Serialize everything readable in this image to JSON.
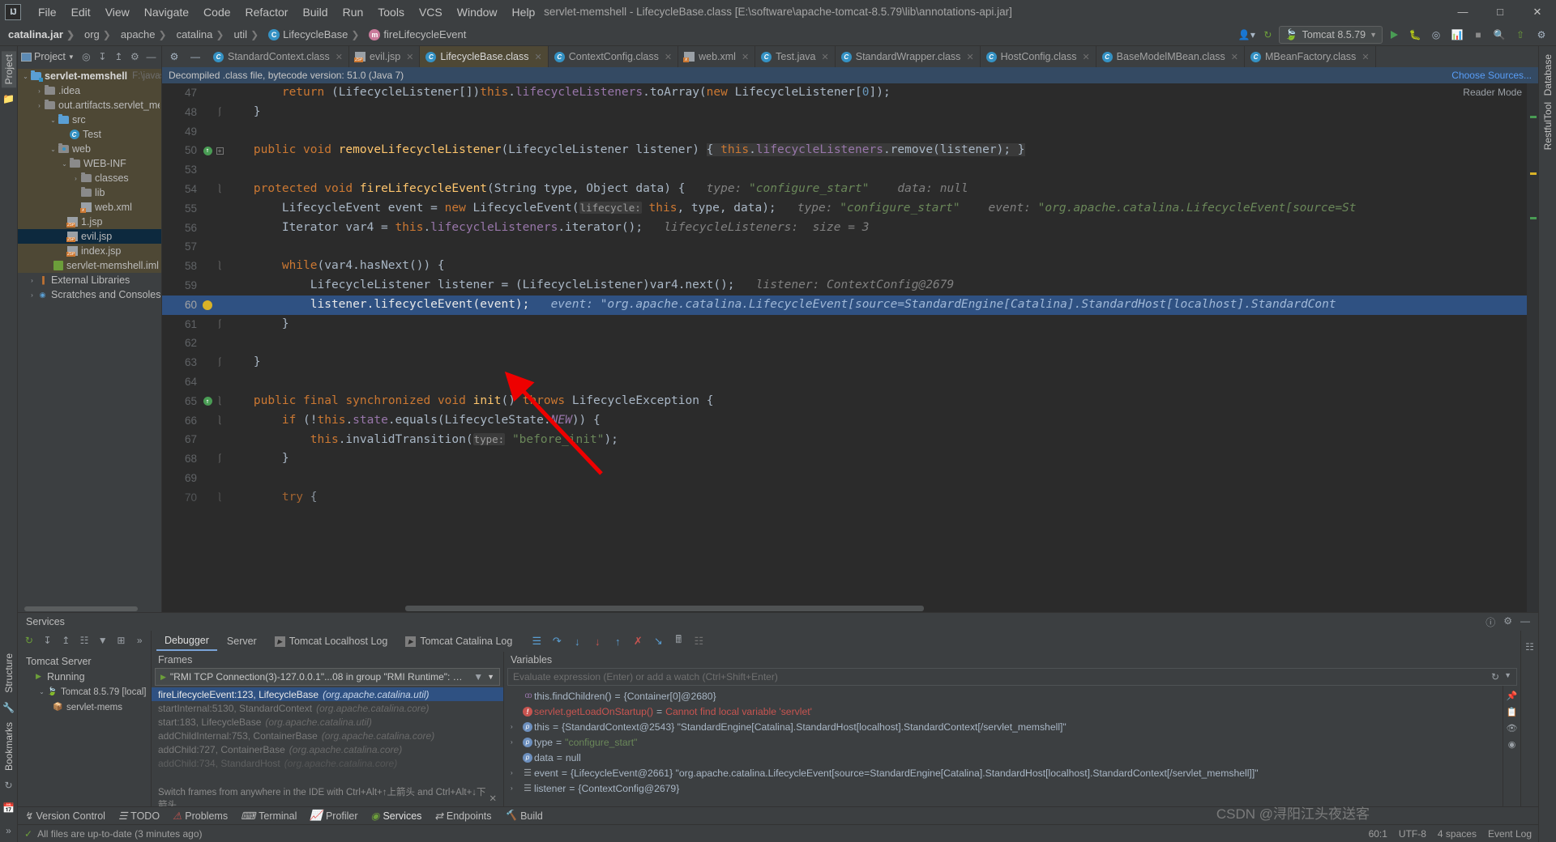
{
  "menu": {
    "logo": "IJ",
    "items": [
      "File",
      "Edit",
      "View",
      "Navigate",
      "Code",
      "Refactor",
      "Build",
      "Run",
      "Tools",
      "VCS",
      "Window",
      "Help"
    ],
    "window_title": "servlet-memshell - LifecycleBase.class [E:\\software\\apache-tomcat-8.5.79\\lib\\annotations-api.jar]",
    "controls": {
      "minimize": "—",
      "maximize": "□",
      "close": "✕"
    }
  },
  "navbar": {
    "breadcrumbs": [
      {
        "label": "catalina.jar",
        "icon": "",
        "bold": true
      },
      {
        "label": "org",
        "icon": ""
      },
      {
        "label": "apache",
        "icon": ""
      },
      {
        "label": "catalina",
        "icon": ""
      },
      {
        "label": "util",
        "icon": ""
      },
      {
        "label": "LifecycleBase",
        "icon": "class-icon"
      },
      {
        "label": "fireLifecycleEvent",
        "icon": "method-icon"
      }
    ],
    "run_config": "Tomcat 8.5.79",
    "buttons": [
      "run-button",
      "debug-button",
      "stop-button",
      "coverage-button",
      "profiler-button",
      "search-button",
      "update-button",
      "settings-button"
    ]
  },
  "sidebar_left": {
    "project_label": "Project",
    "structure_label": "Structure",
    "bookmarks_label": "Bookmarks"
  },
  "sidebar_right": {
    "database_label": "Database",
    "restful_label": "RestfulTool"
  },
  "project": {
    "header": "Project",
    "toolbar_icons": [
      "locate-icon",
      "expand-all-icon",
      "collapse-all-icon",
      "settings-icon",
      "hide-icon"
    ],
    "tree": [
      {
        "depth": 0,
        "arrow": "⌄",
        "icon": "module-folder",
        "label": "servlet-memshell",
        "bold": true,
        "path": "F:\\javasec-e",
        "state": "hi"
      },
      {
        "depth": 1,
        "arrow": "›",
        "icon": "folder",
        "label": ".idea",
        "state": "hi"
      },
      {
        "depth": 1,
        "arrow": "›",
        "icon": "folder",
        "label": "out.artifacts.servlet_memshell",
        "state": "hi"
      },
      {
        "depth": 1,
        "arrow": "⌄",
        "icon": "folder-blue",
        "label": "src",
        "state": "hi"
      },
      {
        "depth": 2,
        "arrow": "",
        "icon": "class-icon",
        "label": "Test",
        "state": "hi"
      },
      {
        "depth": 1,
        "arrow": "⌄",
        "icon": "web-folder",
        "label": "web",
        "state": "hi"
      },
      {
        "depth": 2,
        "arrow": "⌄",
        "icon": "folder",
        "label": "WEB-INF",
        "state": "hi"
      },
      {
        "depth": 3,
        "arrow": "›",
        "icon": "folder",
        "label": "classes",
        "state": "hi"
      },
      {
        "depth": 3,
        "arrow": "",
        "icon": "folder",
        "label": "lib",
        "state": "hi"
      },
      {
        "depth": 3,
        "arrow": "",
        "icon": "xml-icon",
        "label": "web.xml",
        "state": "hi"
      },
      {
        "depth": 2,
        "arrow": "",
        "icon": "jsp-icon",
        "label": "1.jsp",
        "state": "hi"
      },
      {
        "depth": 2,
        "arrow": "",
        "icon": "jsp-icon",
        "label": "evil.jsp",
        "state": "sel"
      },
      {
        "depth": 2,
        "arrow": "",
        "icon": "jsp-icon",
        "label": "index.jsp",
        "state": "hi"
      },
      {
        "depth": 1,
        "arrow": "",
        "icon": "iml-icon",
        "label": "servlet-memshell.iml",
        "state": "hi"
      },
      {
        "depth": 0,
        "arrow": "›",
        "icon": "lib-icon",
        "label": "External Libraries",
        "state": ""
      },
      {
        "depth": 0,
        "arrow": "›",
        "icon": "scratch-icon",
        "label": "Scratches and Consoles",
        "state": ""
      }
    ]
  },
  "editor": {
    "tabs": [
      {
        "label": "StandardContext.class",
        "icon": "class-icon",
        "active": false
      },
      {
        "label": "evil.jsp",
        "icon": "jsp-icon",
        "active": false
      },
      {
        "label": "LifecycleBase.class",
        "icon": "class-icon",
        "active": true
      },
      {
        "label": "ContextConfig.class",
        "icon": "class-icon",
        "active": false
      },
      {
        "label": "web.xml",
        "icon": "xml-icon",
        "active": false
      },
      {
        "label": "Test.java",
        "icon": "class-icon",
        "active": false
      },
      {
        "label": "StandardWrapper.class",
        "icon": "class-icon",
        "active": false
      },
      {
        "label": "HostConfig.class",
        "icon": "class-icon",
        "active": false
      },
      {
        "label": "BaseModelMBean.class",
        "icon": "class-icon",
        "active": false
      },
      {
        "label": "MBeanFactory.class",
        "icon": "class-icon",
        "active": false
      }
    ],
    "decompiled_notice": "Decompiled .class file, bytecode version: 51.0 (Java 7)",
    "choose_sources": "Choose Sources...",
    "reader_mode": "Reader Mode",
    "lines": [
      {
        "num": "47",
        "marker": "",
        "fold": ""
      },
      {
        "num": "48",
        "marker": "",
        "fold": "brace-up"
      },
      {
        "num": "49",
        "marker": "",
        "fold": ""
      },
      {
        "num": "50",
        "marker": "green-modified",
        "fold": "plus"
      },
      {
        "num": "53",
        "marker": "",
        "fold": ""
      },
      {
        "num": "54",
        "marker": "",
        "fold": "brace-down"
      },
      {
        "num": "55",
        "marker": "",
        "fold": ""
      },
      {
        "num": "56",
        "marker": "",
        "fold": ""
      },
      {
        "num": "57",
        "marker": "",
        "fold": ""
      },
      {
        "num": "58",
        "marker": "",
        "fold": "brace-down"
      },
      {
        "num": "59",
        "marker": "",
        "fold": ""
      },
      {
        "num": "60",
        "marker": "bulb",
        "fold": "",
        "highlighted": true
      },
      {
        "num": "61",
        "marker": "",
        "fold": "brace-up"
      },
      {
        "num": "62",
        "marker": "",
        "fold": ""
      },
      {
        "num": "63",
        "marker": "",
        "fold": "brace-up"
      },
      {
        "num": "64",
        "marker": "",
        "fold": ""
      },
      {
        "num": "65",
        "marker": "green-modified",
        "fold": "brace-down"
      },
      {
        "num": "66",
        "marker": "",
        "fold": "brace-down"
      },
      {
        "num": "67",
        "marker": "",
        "fold": ""
      },
      {
        "num": "68",
        "marker": "",
        "fold": "brace-up"
      },
      {
        "num": "69",
        "marker": "",
        "fold": ""
      },
      {
        "num": "70",
        "marker": "",
        "fold": "brace-down"
      }
    ],
    "code_text": {
      "l47": "return (LifecycleListener[])this.lifecycleListeners.toArray(new LifecycleListener[0]);",
      "l48": "}",
      "l50": "public void removeLifecycleListener(LifecycleListener listener) { this.lifecycleListeners.remove(listener); }",
      "l54": "protected void fireLifecycleEvent(String type, Object data) {",
      "l54_hint1": "type: \"configure_start\"",
      "l54_hint2": "data: null",
      "l55": "LifecycleEvent event = new LifecycleEvent( lifecycle: this, type, data);",
      "l55_hint1": "type: \"configure_start\"",
      "l55_hint2": "event: \"org.apache.catalina.LifecycleEvent[source=St",
      "l56": "Iterator var4 = this.lifecycleListeners.iterator();",
      "l56_hint": "lifecycleListeners:  size = 3",
      "l58": "while(var4.hasNext()) {",
      "l59": "LifecycleListener listener = (LifecycleListener)var4.next();",
      "l59_hint": "listener: ContextConfig@2679",
      "l60": "listener.lifecycleEvent(event);",
      "l60_hint": "event: \"org.apache.catalina.LifecycleEvent[source=StandardEngine[Catalina].StandardHost[localhost].StandardCont",
      "l61": "}",
      "l63": "}",
      "l65": "public final synchronized void init() throws LifecycleException {",
      "l66": "if (!this.state.equals(LifecycleState.NEW)) {",
      "l67": "this.invalidTransition( type: \"before_init\");",
      "l68": "}",
      "l70": "try {"
    }
  },
  "services": {
    "title": "Services",
    "left_toolbar": [
      "rerun-icon",
      "expand-icon",
      "collapse-icon",
      "group-icon",
      "filter-icon",
      "add-icon",
      "more-icon"
    ],
    "tree": [
      {
        "label": "Tomcat Server",
        "icon": "",
        "depth": 0
      },
      {
        "label": "Running",
        "icon": "run-icon",
        "depth": 1
      },
      {
        "label": "Tomcat 8.5.79 [local]",
        "icon": "tomcat-icon",
        "depth": 2,
        "arrow": "⌄"
      },
      {
        "label": "servlet-mems",
        "icon": "artifact-icon",
        "depth": 3
      }
    ],
    "debug_tabs": [
      {
        "label": "Debugger",
        "active": true
      },
      {
        "label": "Server",
        "active": false
      },
      {
        "label": "Tomcat Localhost Log",
        "active": false,
        "icon": "console-icon"
      },
      {
        "label": "Tomcat Catalina Log",
        "active": false,
        "icon": "console-icon"
      }
    ],
    "debug_toolbar": [
      "mute-breakpoints-icon",
      "step-over-icon",
      "step-into-icon",
      "force-step-into-icon",
      "step-out-icon",
      "drop-frame-icon",
      "run-to-cursor-icon",
      "evaluate-icon",
      "settings-icon"
    ],
    "frames": {
      "title": "Frames",
      "thread": "\"RMI TCP Connection(3)-127.0.0.1\"...08 in group \"RMI Runtime\": RUNNING",
      "items": [
        {
          "method": "fireLifecycleEvent:123, LifecycleBase",
          "pkg": "(org.apache.catalina.util)",
          "selected": true
        },
        {
          "method": "startInternal:5130, StandardContext",
          "pkg": "(org.apache.catalina.core)",
          "selected": false
        },
        {
          "method": "start:183, LifecycleBase",
          "pkg": "(org.apache.catalina.util)",
          "selected": false
        },
        {
          "method": "addChildInternal:753, ContainerBase",
          "pkg": "(org.apache.catalina.core)",
          "selected": false
        },
        {
          "method": "addChild:727, ContainerBase",
          "pkg": "(org.apache.catalina.core)",
          "selected": false
        },
        {
          "method": "addChild:734, StandardHost",
          "pkg": "(org.apache.catalina.core)",
          "selected": false
        }
      ],
      "footer": "Switch frames from anywhere in the IDE with Ctrl+Alt+↑上箭头 and Ctrl+Alt+↓下箭头"
    },
    "variables": {
      "title": "Variables",
      "watch_placeholder": "Evaluate expression (Enter) or add a watch (Ctrl+Shift+Enter)",
      "items": [
        {
          "expand": "",
          "icon": "method-result-icon",
          "name": "this.findChildren()",
          "eq": "=",
          "value": "{Container[0]@2680}",
          "vclass": "gray"
        },
        {
          "expand": "",
          "icon": "error-icon",
          "name": "servlet.getLoadOnStartup()",
          "eq": "=",
          "value": "Cannot find local variable 'servlet'",
          "vclass": "err"
        },
        {
          "expand": "›",
          "icon": "param-icon",
          "name": "this",
          "eq": "=",
          "value": "{StandardContext@2543} \"StandardEngine[Catalina].StandardHost[localhost].StandardContext[/servlet_memshell]\"",
          "vclass": "gray"
        },
        {
          "expand": "›",
          "icon": "param-icon",
          "name": "type",
          "eq": "=",
          "value": "\"configure_start\"",
          "vclass": ""
        },
        {
          "expand": "",
          "icon": "param-icon",
          "name": "data",
          "eq": "=",
          "value": "null",
          "vclass": "gray"
        },
        {
          "expand": "›",
          "icon": "list-icon",
          "name": "event",
          "eq": "=",
          "value": "{LifecycleEvent@2661} \"org.apache.catalina.LifecycleEvent[source=StandardEngine[Catalina].StandardHost[localhost].StandardContext[/servlet_memshell]]\"",
          "vclass": "gray"
        },
        {
          "expand": "›",
          "icon": "list-icon",
          "name": "listener",
          "eq": "=",
          "value": "{ContextConfig@2679}",
          "vclass": "gray"
        }
      ]
    }
  },
  "toolwindows": {
    "items": [
      {
        "label": "Version Control",
        "icon": "vcs-icon",
        "active": false
      },
      {
        "label": "TODO",
        "icon": "todo-icon",
        "active": false
      },
      {
        "label": "Problems",
        "icon": "problems-icon",
        "active": false
      },
      {
        "label": "Terminal",
        "icon": "terminal-icon",
        "active": false
      },
      {
        "label": "Profiler",
        "icon": "profiler-icon",
        "active": false
      },
      {
        "label": "Services",
        "icon": "services-icon",
        "active": true
      },
      {
        "label": "Endpoints",
        "icon": "endpoints-icon",
        "active": false
      },
      {
        "label": "Build",
        "icon": "build-icon",
        "active": false
      }
    ]
  },
  "statusbar": {
    "message": "All files are up-to-date (3 minutes ago)",
    "position": "60:1",
    "encoding": "UTF-8",
    "indent": "4 spaces",
    "branch": "Event Log"
  },
  "watermark": "CSDN @浔阳江头夜送客",
  "colors": {
    "accent": "#4b6eaf",
    "selected_line": "#2f5182",
    "tab_active": "#4e4835",
    "keyword": "#cc7832",
    "string": "#6a8759",
    "method": "#ffc66d",
    "field": "#9876aa",
    "error": "#c75450"
  }
}
